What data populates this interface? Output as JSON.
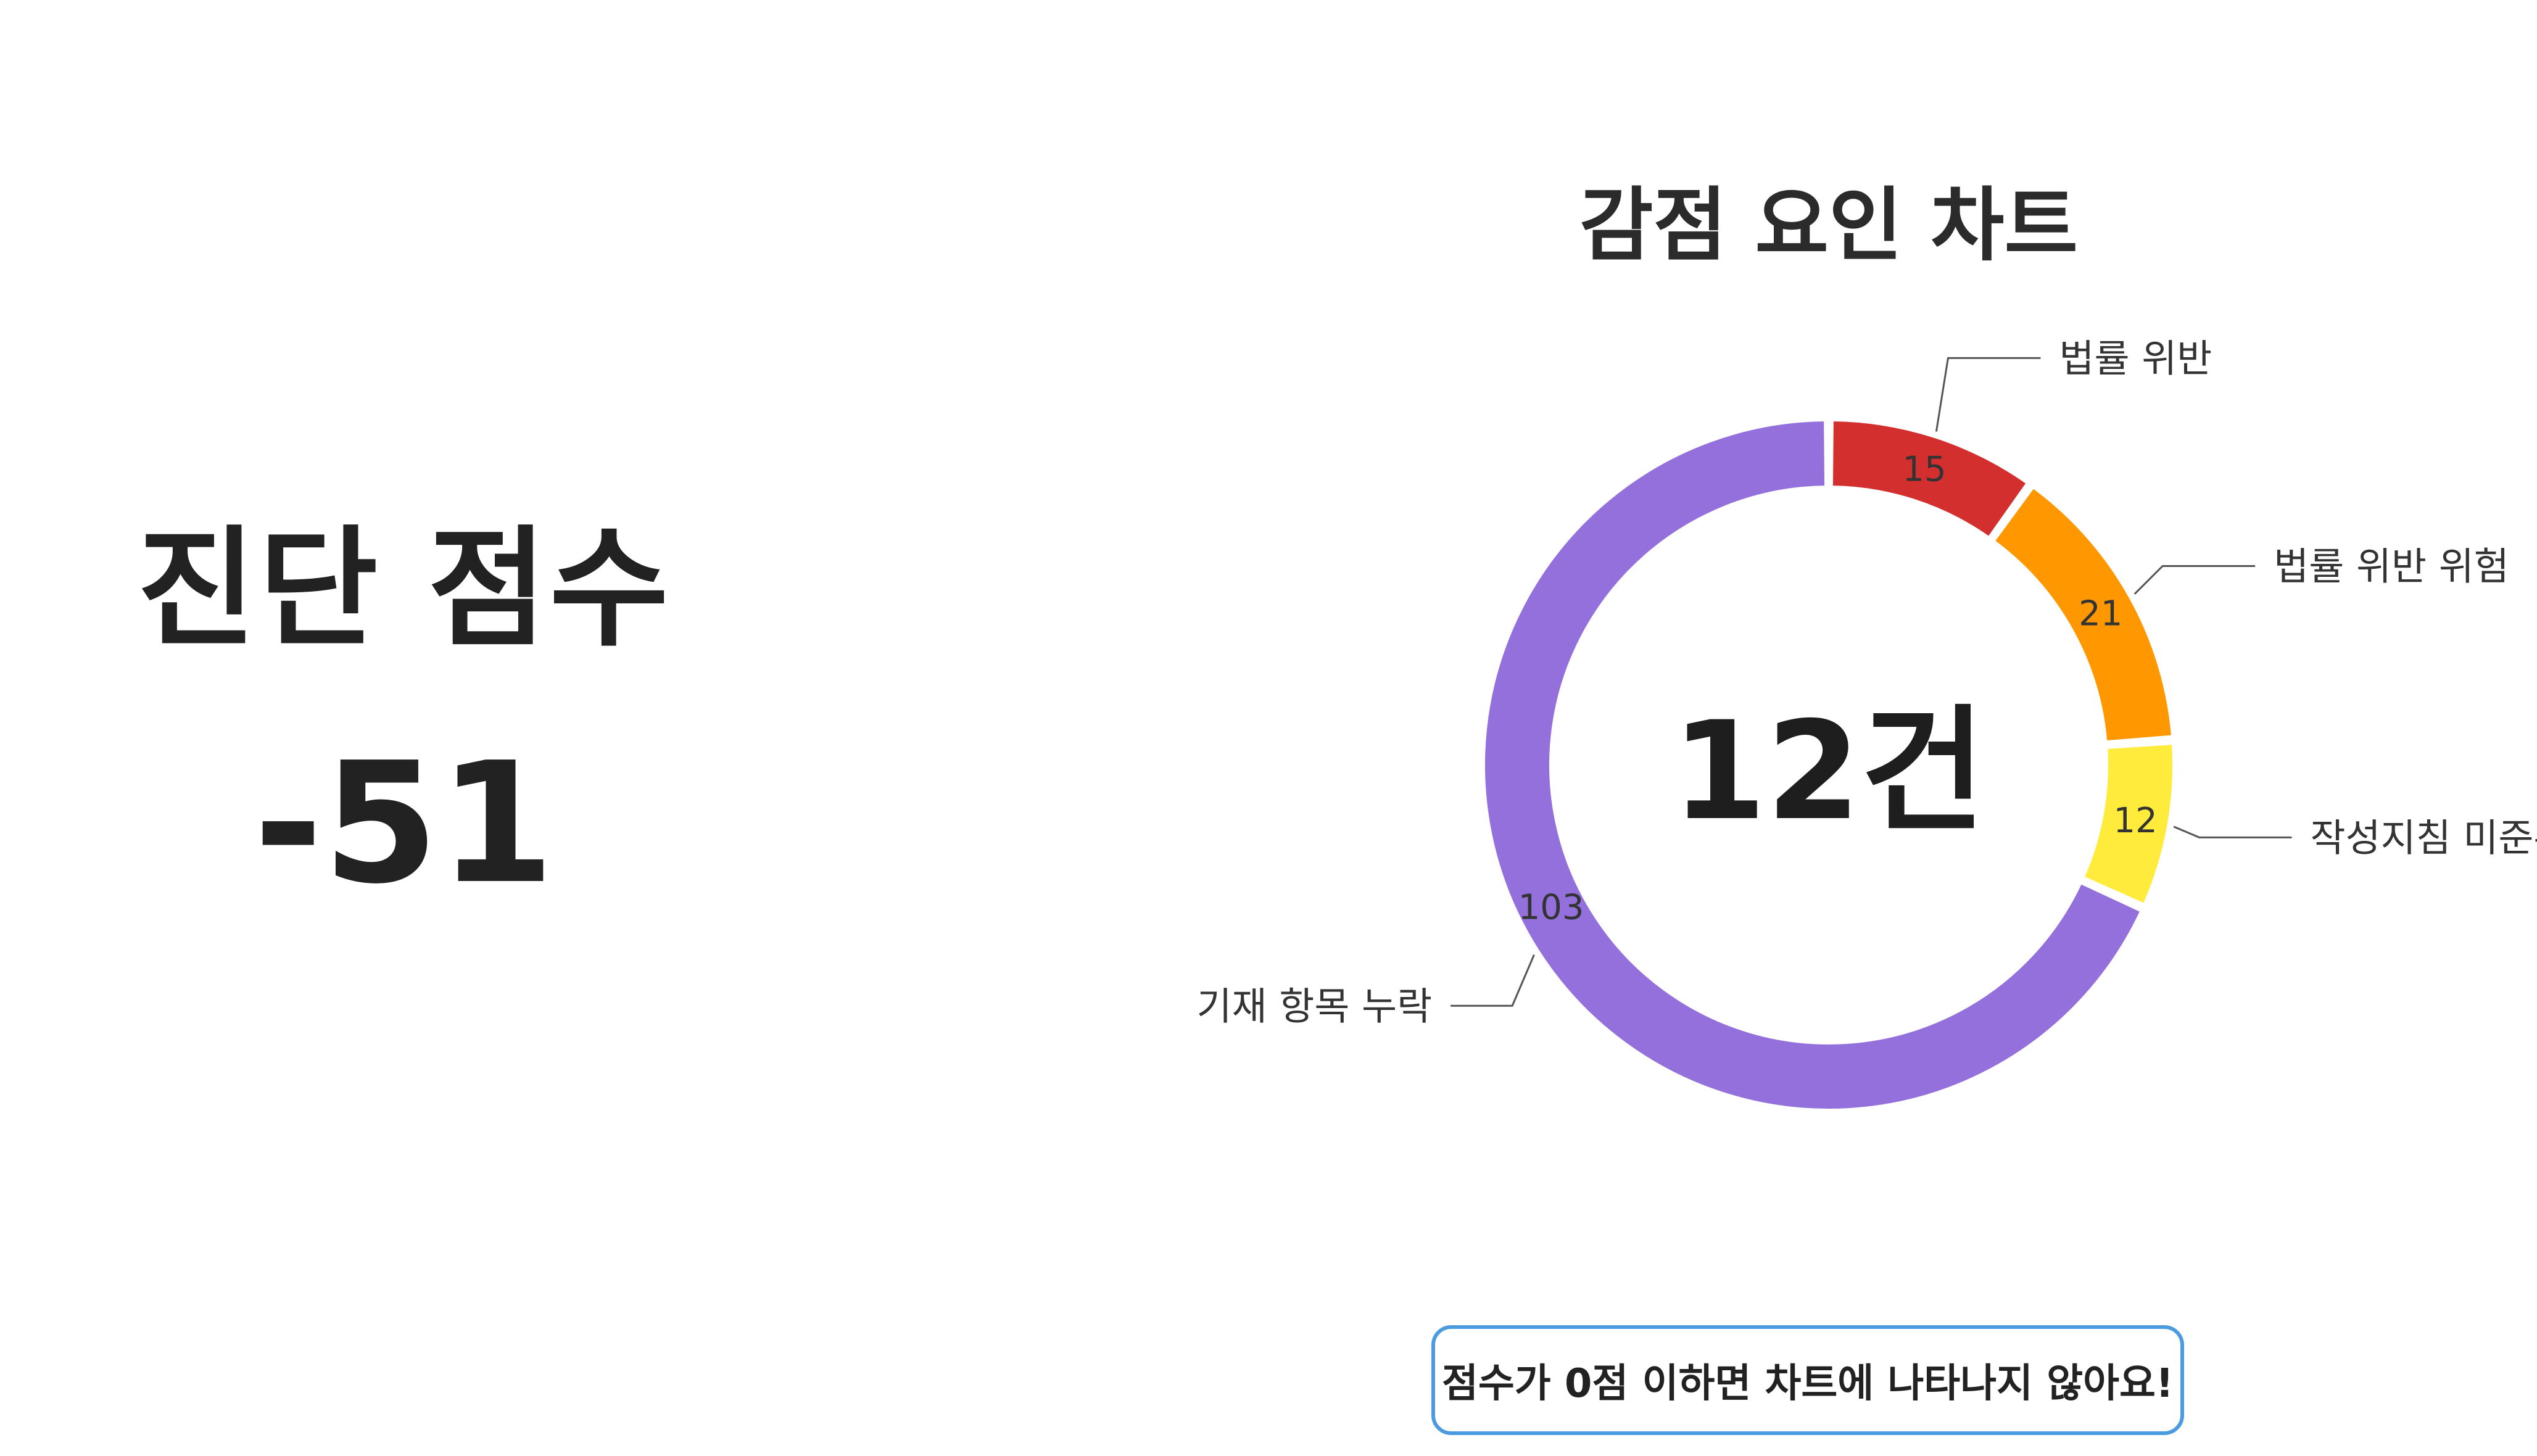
{
  "score_panel": {
    "title": "진단 점수",
    "value": "-51"
  },
  "chart_title": "감점 요인 차트",
  "center_total": "12건",
  "notice": "점수가 0점 이하면 차트에 나타나지 않아요!",
  "chart_data": {
    "type": "pie",
    "title": "감점 요인 차트",
    "donut": true,
    "center_label": "12건",
    "categories": [
      "법률 위반",
      "법률 위반 위험",
      "작성지침 미준수",
      "기재 항목 누락"
    ],
    "values": [
      15,
      21,
      12,
      103
    ],
    "colors": [
      "#d32f2f",
      "#ff9800",
      "#ffeb3b",
      "#9370db"
    ],
    "legend": "none",
    "labels_with_leader_lines": true
  }
}
